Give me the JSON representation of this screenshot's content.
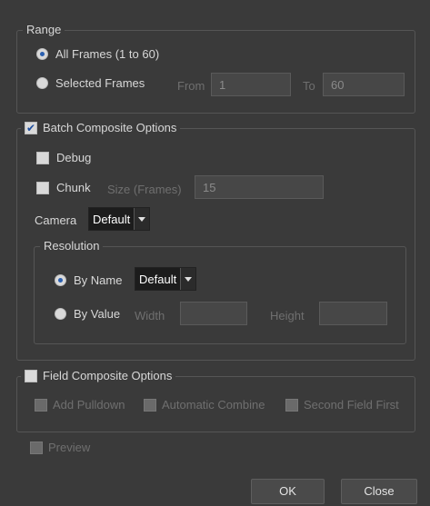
{
  "range": {
    "title": "Range",
    "all_frames_label": "All Frames (1 to 60)",
    "selected_frames_label": "Selected Frames",
    "from_label": "From",
    "from_value": "1",
    "to_label": "To",
    "to_value": "60",
    "selected": "all"
  },
  "batch": {
    "title": "Batch Composite Options",
    "checked": true,
    "debug_label": "Debug",
    "chunk_label": "Chunk",
    "size_label": "Size (Frames)",
    "size_value": "15",
    "camera_label": "Camera",
    "camera_value": "Default",
    "resolution": {
      "title": "Resolution",
      "by_name_label": "By Name",
      "by_name_value": "Default",
      "by_value_label": "By Value",
      "width_label": "Width",
      "height_label": "Height",
      "selected": "by_name"
    }
  },
  "field": {
    "title": "Field Composite Options",
    "add_pulldown_label": "Add Pulldown",
    "automatic_combine_label": "Automatic Combine",
    "second_field_first_label": "Second Field First"
  },
  "preview_label": "Preview",
  "buttons": {
    "ok": "OK",
    "close": "Close"
  }
}
